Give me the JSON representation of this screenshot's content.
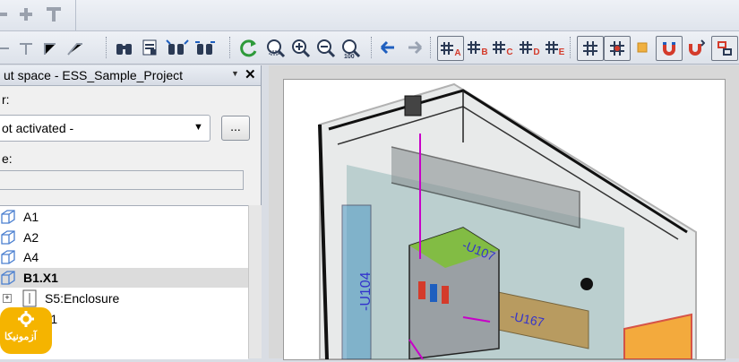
{
  "panel": {
    "title": "ut space - ESS_Sample_Project",
    "filter_label": "r:",
    "filter_select_value": "ot activated -",
    "more_button_label": "...",
    "name_label": "e:",
    "name_input_value": "",
    "tree_items": [
      {
        "label": "A1",
        "bold": false
      },
      {
        "label": "A2",
        "bold": false
      },
      {
        "label": "A4",
        "bold": false
      },
      {
        "label": "B1.X1",
        "bold": true
      },
      {
        "label": "S5:Enclosure",
        "bold": false
      },
      {
        "label": "B2.X1",
        "bold": false
      },
      {
        "label": "1",
        "bold": false
      }
    ]
  },
  "toolbar": {
    "snap_buttons": [
      "A",
      "B",
      "C",
      "D",
      "E"
    ]
  },
  "model_labels": {
    "u104": "-U104",
    "u107": "-U107",
    "u167": "-U167"
  },
  "badge": {
    "text": "آزمونیکا"
  },
  "colors": {
    "accent_blue": "#1f5fbf",
    "accent_green": "#2e9a3a",
    "magnet_red": "#d43b2b",
    "model_label_color": "#3333cc"
  }
}
